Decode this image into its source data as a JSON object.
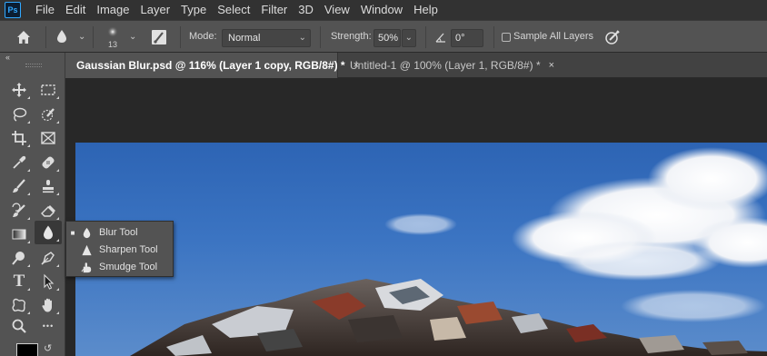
{
  "app": {
    "logo_text": "Ps"
  },
  "menu": [
    "File",
    "Edit",
    "Image",
    "Layer",
    "Type",
    "Select",
    "Filter",
    "3D",
    "View",
    "Window",
    "Help"
  ],
  "options": {
    "brush_size": "13",
    "mode_label": "Mode:",
    "mode_value": "Normal",
    "strength_label": "Strength:",
    "strength_value": "50%",
    "angle_value": "0°",
    "sample_all_layers_label": "Sample All Layers",
    "sample_all_layers_checked": false
  },
  "toolbar": {
    "collapse_glyph": "‹‹",
    "tools": [
      {
        "name": "move-tool",
        "icon": "move-icon"
      },
      {
        "name": "rectangular-marquee-tool",
        "icon": "marquee-icon"
      },
      {
        "name": "lasso-tool",
        "icon": "lasso-icon"
      },
      {
        "name": "quick-selection-tool",
        "icon": "quick-selection-icon"
      },
      {
        "name": "crop-tool",
        "icon": "crop-icon"
      },
      {
        "name": "frame-tool",
        "icon": "frame-icon"
      },
      {
        "name": "eyedropper-tool",
        "icon": "eyedropper-icon"
      },
      {
        "name": "spot-healing-brush-tool",
        "icon": "bandage-icon"
      },
      {
        "name": "brush-tool",
        "icon": "brush-icon"
      },
      {
        "name": "clone-stamp-tool",
        "icon": "stamp-icon"
      },
      {
        "name": "history-brush-tool",
        "icon": "history-brush-icon"
      },
      {
        "name": "eraser-tool",
        "icon": "eraser-icon"
      },
      {
        "name": "gradient-tool",
        "icon": "gradient-icon"
      },
      {
        "name": "blur-tool",
        "icon": "drop-icon"
      },
      {
        "name": "dodge-tool",
        "icon": "dodge-icon"
      },
      {
        "name": "pen-tool",
        "icon": "pen-icon"
      },
      {
        "name": "type-tool",
        "icon": "type-icon",
        "glyph": "T"
      },
      {
        "name": "path-selection-tool",
        "icon": "arrow-icon"
      },
      {
        "name": "custom-shape-tool",
        "icon": "shape-icon"
      },
      {
        "name": "hand-tool",
        "icon": "hand-icon"
      },
      {
        "name": "zoom-tool",
        "icon": "zoom-icon"
      },
      {
        "name": "more-tools",
        "icon": "ellipsis-icon",
        "glyph": "•••"
      }
    ],
    "foreground_color": "#000000",
    "background_color": "#ffffff"
  },
  "tabs": [
    {
      "label": "Gaussian Blur.psd @ 116% (Layer 1 copy, RGB/8#) *",
      "active": true,
      "close": "×"
    },
    {
      "label": "Untitled-1 @ 100% (Layer 1, RGB/8#) *",
      "active": false,
      "close": "×"
    }
  ],
  "flyout": {
    "items": [
      {
        "label": "Blur Tool",
        "selected": true,
        "icon": "drop-icon"
      },
      {
        "label": "Sharpen Tool",
        "selected": false,
        "icon": "triangle-icon"
      },
      {
        "label": "Smudge Tool",
        "selected": false,
        "icon": "finger-icon"
      }
    ],
    "bullet": "■"
  },
  "colors": {
    "accent": "#31a8ff",
    "panel": "#535353",
    "menubar": "#323232",
    "workspace": "#282828",
    "sky": "#2d64b4"
  }
}
